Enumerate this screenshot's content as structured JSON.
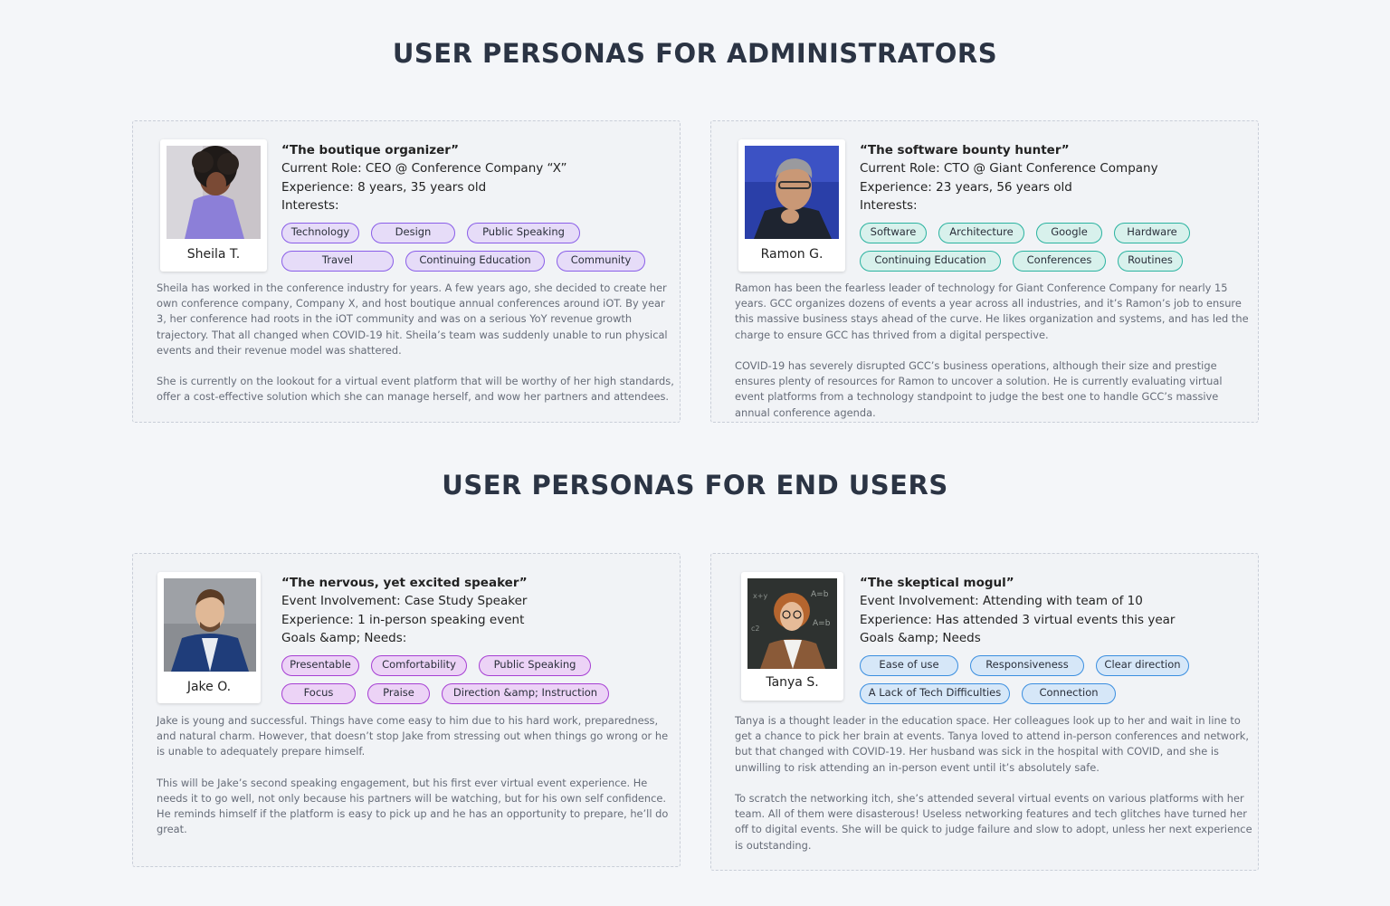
{
  "sections": {
    "admins_title": "USER PERSONAS FOR ADMINISTRATORS",
    "end_users_title": "USER PERSONAS FOR END USERS"
  },
  "personas": [
    {
      "name": "Sheila T.",
      "tagline": "“The boutique organizer”",
      "line1": "Current Role: CEO @ Conference Company “X”",
      "line2": "Experience: 8 years, 35 years old",
      "line3": "Interests:",
      "tags_row1": [
        "Technology",
        "Design",
        "Public Speaking"
      ],
      "tags_row2": [
        "Travel",
        "Continuing Education",
        "Community"
      ],
      "tag_color": "#8a5ee8",
      "desc1": "Sheila has worked in the conference industry for years. A few years ago, she decided to create her own conference company, Company X, and host boutique annual conferences around iOT. By year 3, her conference had roots in the iOT community and was on a serious YoY revenue growth trajectory. That all changed when COVID-19 hit. Sheila’s team was suddenly unable to run physical events and their revenue model was shattered.",
      "desc2": "She is currently on the lookout for a virtual event platform that will be worthy of her high standards, offer a cost-effective solution which she can manage herself, and wow her partners and attendees."
    },
    {
      "name": "Ramon G.",
      "tagline": "“The software bounty hunter”",
      "line1": "Current Role: CTO @ Giant Conference Company",
      "line2": "Experience: 23 years, 56 years old",
      "line3": "Interests:",
      "tags_row1": [
        "Software",
        "Architecture",
        "Google",
        "Hardware"
      ],
      "tags_row2": [
        "Continuing Education",
        "Conferences",
        "Routines"
      ],
      "tag_color": "#2bb3a0",
      "desc1": "Ramon has been the fearless leader of technology for Giant Conference Company for nearly 15 years. GCC organizes dozens of events a year across all industries, and it’s Ramon’s job to ensure this massive business stays ahead of the curve. He likes organization and systems, and has led the charge to ensure GCC has thrived from a digital perspective.",
      "desc2": "COVID-19 has severely disrupted GCC’s business operations, although their size and prestige ensures plenty of resources for Ramon to uncover a solution. He is currently evaluating virtual event platforms from a technology standpoint to judge the best one to handle GCC’s massive annual conference agenda."
    },
    {
      "name": "Jake O.",
      "tagline": "“The nervous, yet excited speaker”",
      "line1": "Event Involvement: Case Study Speaker",
      "line2": "Experience: 1 in-person speaking event",
      "line3": "Goals &amp; Needs:",
      "tags_row1": [
        "Presentable",
        "Comfortability",
        "Public Speaking"
      ],
      "tags_row2": [
        "Focus",
        "Praise",
        "Direction &amp; Instruction"
      ],
      "tag_color": "#a63fd3",
      "desc1": "Jake is young and successful. Things have come easy to him due to his hard work, preparedness, and natural charm. However, that doesn’t stop Jake from stressing out when things go wrong or he is unable to adequately prepare himself.",
      "desc2": "This will be Jake’s second speaking engagement, but his first ever virtual event experience. He needs it to go well, not only because his partners will be watching, but for his own self confidence. He reminds himself if the platform is easy to pick up and he has an opportunity to prepare, he’ll do great."
    },
    {
      "name": "Tanya S.",
      "tagline": "“The skeptical mogul”",
      "line1": "Event Involvement: Attending with team of 10",
      "line2": "Experience: Has attended 3 virtual events this year",
      "line3": "Goals &amp; Needs",
      "tags_row1": [
        "Ease of use",
        "Responsiveness",
        "Clear direction"
      ],
      "tags_row2": [
        "A Lack of Tech Difficulties",
        "Connection"
      ],
      "tag_color": "#3a8ee0",
      "desc1": "Tanya is a thought leader in the education space. Her colleagues look up to her and wait in line to get a chance to pick her brain at events. Tanya loved to attend in-person conferences and network, but that changed with COVID-19. Her husband was sick in the hospital with COVID, and she is unwilling to risk attending an in-person event until it’s absolutely safe.",
      "desc2": "To scratch the networking itch, she’s attended several virtual events on various platforms with her team. All of them were disasterous! Useless networking features and tech glitches have turned her off to digital events. She will be quick to judge failure and slow to adopt, unless her next experience is outstanding."
    }
  ]
}
